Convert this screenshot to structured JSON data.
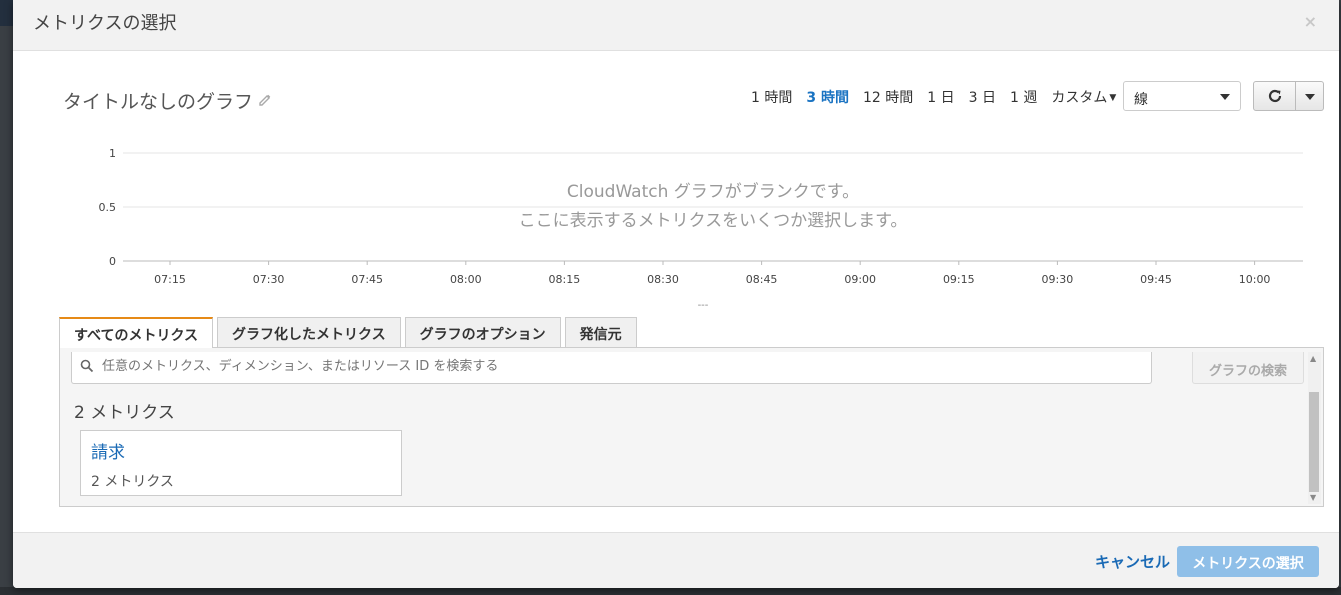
{
  "dialog": {
    "title": "メトリクスの選択",
    "close_glyph": "×"
  },
  "graph": {
    "title": "タイトルなしのグラフ"
  },
  "time_ranges": [
    {
      "label": "1 時間",
      "active": false
    },
    {
      "label": "3 時間",
      "active": true
    },
    {
      "label": "12 時間",
      "active": false
    },
    {
      "label": "1 日",
      "active": false
    },
    {
      "label": "3 日",
      "active": false
    },
    {
      "label": "1 週",
      "active": false
    }
  ],
  "custom_range": {
    "label": "カスタム"
  },
  "chart_type_select": {
    "value": "線"
  },
  "icons": {
    "edit": "pencil-icon",
    "refresh": "refresh-icon",
    "search": "search-icon",
    "dropdown": "caret-down-icon"
  },
  "chart_data": {
    "type": "line",
    "title": "",
    "x": [
      "07:15",
      "07:30",
      "07:45",
      "08:00",
      "08:15",
      "08:30",
      "08:45",
      "09:00",
      "09:15",
      "09:30",
      "09:45",
      "10:00"
    ],
    "y_ticks": [
      "1",
      "0.5",
      "0"
    ],
    "ylim": [
      0,
      1
    ],
    "series": [],
    "grid": true,
    "empty_message_line1": "CloudWatch グラフがブランクです。",
    "empty_message_line2": "ここに表示するメトリクスをいくつか選択します。",
    "legend_placeholder": "---"
  },
  "tabs": [
    {
      "label": "すべてのメトリクス",
      "active": true
    },
    {
      "label": "グラフ化したメトリクス",
      "active": false
    },
    {
      "label": "グラフのオプション",
      "active": false
    },
    {
      "label": "発信元",
      "active": false
    }
  ],
  "search": {
    "placeholder": "任意のメトリクス、ディメンション、またはリソース ID を検索する",
    "button_label": "グラフの検索"
  },
  "results": {
    "count_label": "2 メトリクス",
    "cards": [
      {
        "name": "請求",
        "sub": "2 メトリクス"
      }
    ]
  },
  "footer": {
    "cancel_label": "キャンセル",
    "select_label": "メトリクスの選択"
  },
  "colors": {
    "active_link": "#1a73c2",
    "tab_accent": "#e68a17",
    "primary_button": "#8fbfe8",
    "grid_line": "#e5e5e5"
  }
}
